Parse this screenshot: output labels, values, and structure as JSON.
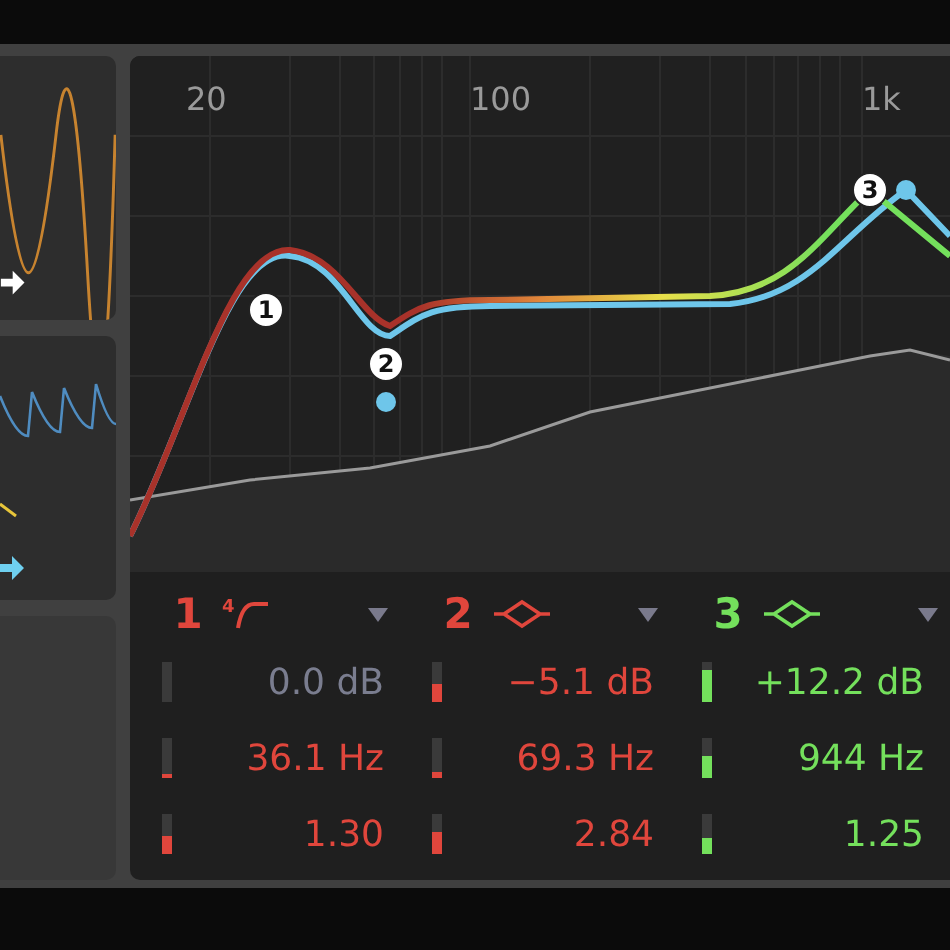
{
  "graph": {
    "freq_labels": [
      "20",
      "100",
      "1k"
    ],
    "nodes": [
      {
        "label": "1"
      },
      {
        "label": "2"
      },
      {
        "label": "3"
      }
    ]
  },
  "bands": [
    {
      "number": "1",
      "color": "#e0463c",
      "kind": "lowcut",
      "slope": "4",
      "params": [
        {
          "value": "0.0 dB",
          "active": false,
          "level": 0
        },
        {
          "value": "36.1 Hz",
          "active": true,
          "level": 0.1
        },
        {
          "value": "1.30",
          "active": true,
          "level": 0.45
        }
      ]
    },
    {
      "number": "2",
      "color": "#e0463c",
      "kind": "bell",
      "params": [
        {
          "value": "−5.1 dB",
          "active": true,
          "level": 0.45
        },
        {
          "value": "69.3 Hz",
          "active": true,
          "level": 0.15
        },
        {
          "value": "2.84",
          "active": true,
          "level": 0.55
        }
      ]
    },
    {
      "number": "3",
      "color": "#74e05c",
      "kind": "bell",
      "params": [
        {
          "value": "+12.2 dB",
          "active": true,
          "level": 0.8
        },
        {
          "value": "944 Hz",
          "active": true,
          "level": 0.55
        },
        {
          "value": "1.25",
          "active": true,
          "level": 0.4
        }
      ]
    }
  ]
}
